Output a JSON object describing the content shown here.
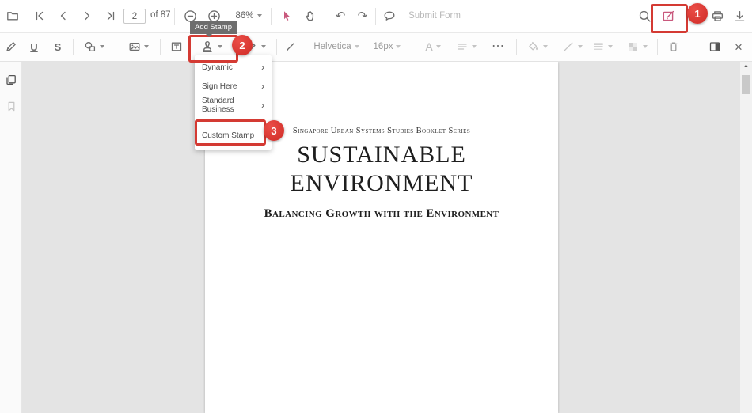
{
  "top_toolbar": {
    "page_number": "2",
    "page_count": "of 87",
    "zoom_level": "86%",
    "submit_form": "Submit Form"
  },
  "edit_toolbar": {
    "tooltip": "Add Stamp",
    "font_family": "Helvetica",
    "font_size": "16px"
  },
  "stamp_menu": {
    "items": [
      {
        "label": "Dynamic"
      },
      {
        "label": "Sign Here"
      },
      {
        "label": "Standard Business"
      },
      {
        "label": "Custom Stamp"
      }
    ]
  },
  "callouts": {
    "step1": "1",
    "step2": "2",
    "step3": "3"
  },
  "document": {
    "series": "Singapore Urban Systems Studies Booklet Series",
    "title_line1": "SUSTAINABLE",
    "title_line2": "ENVIRONMENT",
    "subtitle": "Balancing Growth with the Environment"
  },
  "icons": {
    "undo": "↶",
    "redo": "↷",
    "more": "⋯",
    "close": "×",
    "underline": "U",
    "strikethrough": "S",
    "font_color": "A",
    "submenu_chevron": "›",
    "scroll_up": "▲"
  },
  "colors": {
    "accent_pink": "#c9597d",
    "callout_red": "#d43a33",
    "canvas_bg": "#e4e4e4",
    "toolbar_bg": "#ffffff"
  }
}
